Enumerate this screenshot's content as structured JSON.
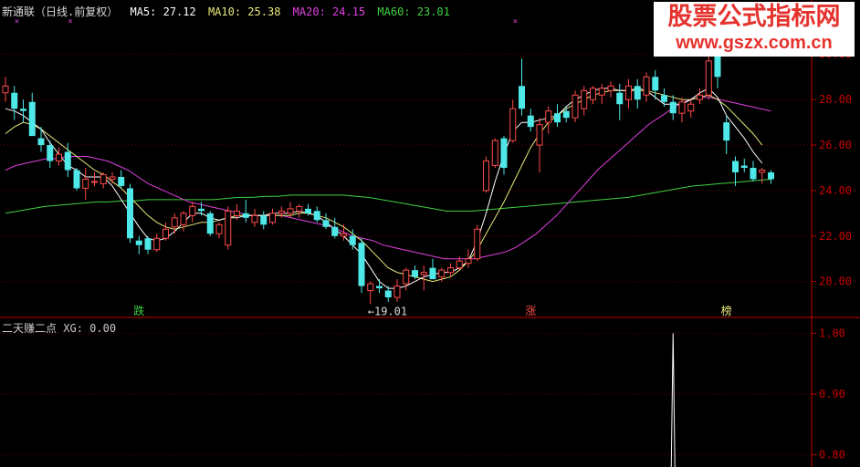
{
  "header": {
    "stock": "新通联（日线.前复权）",
    "ma5": "MA5: 27.12",
    "ma10": "MA10: 25.38",
    "ma20": "MA20: 24.15",
    "ma60": "MA60: 23.01"
  },
  "watermark": {
    "line1": "股票公式指标网",
    "line2": "www.gszx.com.cn"
  },
  "sub_header": {
    "title": "二天赚二点",
    "xg": "XG: 0.00"
  },
  "markers": {
    "low_label": "←19.01",
    "die": "跌",
    "zhang": "涨",
    "bang": "榜"
  },
  "colors": {
    "up": "#ff4a4a",
    "down": "#4fe8e8",
    "ma5": "#ffffff",
    "ma10": "#e8e87a",
    "ma20": "#e040e0",
    "ma60": "#40d040",
    "axis": "#c80000",
    "tick": "#c80000"
  },
  "chart_data": [
    {
      "type": "candlestick",
      "ylim": [
        18.5,
        31.5
      ],
      "yticks": [
        "30.00",
        "28.00",
        "26.00",
        "24.00",
        "22.00",
        "20.00"
      ],
      "candles": [
        {
          "o": 28.3,
          "h": 29.0,
          "l": 27.9,
          "c": 28.6
        },
        {
          "o": 28.3,
          "h": 28.6,
          "l": 27.1,
          "c": 27.6
        },
        {
          "o": 27.6,
          "h": 28.0,
          "l": 27.0,
          "c": 27.5
        },
        {
          "o": 27.9,
          "h": 28.3,
          "l": 26.9,
          "c": 26.4
        },
        {
          "o": 26.3,
          "h": 26.8,
          "l": 25.7,
          "c": 26.0
        },
        {
          "o": 26.0,
          "h": 26.2,
          "l": 25.0,
          "c": 25.3
        },
        {
          "o": 25.3,
          "h": 25.9,
          "l": 25.1,
          "c": 25.6
        },
        {
          "o": 25.7,
          "h": 26.1,
          "l": 24.6,
          "c": 24.9
        },
        {
          "o": 24.9,
          "h": 25.0,
          "l": 24.0,
          "c": 24.1
        },
        {
          "o": 24.1,
          "h": 25.0,
          "l": 23.6,
          "c": 24.5
        },
        {
          "o": 24.4,
          "h": 24.8,
          "l": 24.2,
          "c": 24.4
        },
        {
          "o": 24.3,
          "h": 24.8,
          "l": 24.1,
          "c": 24.7
        },
        {
          "o": 24.5,
          "h": 24.8,
          "l": 24.3,
          "c": 24.6
        },
        {
          "o": 24.6,
          "h": 24.9,
          "l": 24.1,
          "c": 24.2
        },
        {
          "o": 24.1,
          "h": 24.3,
          "l": 21.7,
          "c": 21.9
        },
        {
          "o": 21.8,
          "h": 22.0,
          "l": 21.2,
          "c": 21.6
        },
        {
          "o": 21.9,
          "h": 22.0,
          "l": 21.2,
          "c": 21.4
        },
        {
          "o": 21.4,
          "h": 22.1,
          "l": 21.3,
          "c": 21.9
        },
        {
          "o": 21.9,
          "h": 22.6,
          "l": 21.8,
          "c": 22.3
        },
        {
          "o": 22.4,
          "h": 23.0,
          "l": 22.1,
          "c": 22.8
        },
        {
          "o": 22.5,
          "h": 23.1,
          "l": 22.2,
          "c": 23.0
        },
        {
          "o": 22.9,
          "h": 23.5,
          "l": 22.6,
          "c": 23.3
        },
        {
          "o": 23.2,
          "h": 23.5,
          "l": 22.9,
          "c": 23.1
        },
        {
          "o": 23.0,
          "h": 23.1,
          "l": 22.0,
          "c": 22.1
        },
        {
          "o": 22.1,
          "h": 22.6,
          "l": 21.9,
          "c": 22.5
        },
        {
          "o": 21.6,
          "h": 23.3,
          "l": 21.4,
          "c": 23.1
        },
        {
          "o": 22.9,
          "h": 23.4,
          "l": 22.7,
          "c": 23.1
        },
        {
          "o": 23.0,
          "h": 23.6,
          "l": 22.6,
          "c": 22.8
        },
        {
          "o": 22.6,
          "h": 23.2,
          "l": 22.4,
          "c": 22.9
        },
        {
          "o": 22.9,
          "h": 23.1,
          "l": 22.3,
          "c": 22.5
        },
        {
          "o": 22.6,
          "h": 23.2,
          "l": 22.5,
          "c": 23.0
        },
        {
          "o": 23.0,
          "h": 23.3,
          "l": 22.8,
          "c": 23.1
        },
        {
          "o": 23.0,
          "h": 23.5,
          "l": 22.8,
          "c": 23.2
        },
        {
          "o": 23.1,
          "h": 23.4,
          "l": 22.8,
          "c": 23.3
        },
        {
          "o": 23.2,
          "h": 23.4,
          "l": 22.9,
          "c": 23.0
        },
        {
          "o": 23.1,
          "h": 23.3,
          "l": 22.6,
          "c": 22.7
        },
        {
          "o": 22.7,
          "h": 23.0,
          "l": 22.3,
          "c": 22.4
        },
        {
          "o": 22.4,
          "h": 22.8,
          "l": 21.9,
          "c": 22.0
        },
        {
          "o": 22.0,
          "h": 22.5,
          "l": 21.8,
          "c": 22.1
        },
        {
          "o": 22.0,
          "h": 22.3,
          "l": 21.4,
          "c": 21.6
        },
        {
          "o": 21.7,
          "h": 21.9,
          "l": 19.5,
          "c": 19.8
        },
        {
          "o": 19.6,
          "h": 20.0,
          "l": 19.01,
          "c": 19.9
        },
        {
          "o": 19.8,
          "h": 20.1,
          "l": 19.5,
          "c": 19.7
        },
        {
          "o": 19.6,
          "h": 19.8,
          "l": 19.1,
          "c": 19.3
        },
        {
          "o": 19.3,
          "h": 20.1,
          "l": 19.1,
          "c": 19.8
        },
        {
          "o": 19.9,
          "h": 20.6,
          "l": 19.6,
          "c": 20.5
        },
        {
          "o": 20.5,
          "h": 20.7,
          "l": 20.1,
          "c": 20.2
        },
        {
          "o": 20.3,
          "h": 20.7,
          "l": 19.6,
          "c": 20.4
        },
        {
          "o": 20.6,
          "h": 21.0,
          "l": 20.4,
          "c": 20.1
        },
        {
          "o": 20.2,
          "h": 20.6,
          "l": 20.0,
          "c": 20.5
        },
        {
          "o": 20.4,
          "h": 20.8,
          "l": 20.2,
          "c": 20.6
        },
        {
          "o": 20.6,
          "h": 21.1,
          "l": 20.5,
          "c": 20.9
        },
        {
          "o": 20.8,
          "h": 21.4,
          "l": 20.6,
          "c": 21.0
        },
        {
          "o": 21.0,
          "h": 22.5,
          "l": 20.9,
          "c": 22.3
        },
        {
          "o": 24.0,
          "h": 25.5,
          "l": 23.9,
          "c": 25.3
        },
        {
          "o": 25.1,
          "h": 26.3,
          "l": 25.0,
          "c": 26.2
        },
        {
          "o": 26.3,
          "h": 26.4,
          "l": 24.7,
          "c": 25.0
        },
        {
          "o": 26.2,
          "h": 28.0,
          "l": 26.1,
          "c": 27.6
        },
        {
          "o": 28.6,
          "h": 29.8,
          "l": 27.3,
          "c": 27.6
        },
        {
          "o": 27.3,
          "h": 27.6,
          "l": 26.6,
          "c": 26.8
        },
        {
          "o": 26.0,
          "h": 27.2,
          "l": 24.8,
          "c": 26.9
        },
        {
          "o": 27.0,
          "h": 27.7,
          "l": 26.5,
          "c": 27.5
        },
        {
          "o": 27.4,
          "h": 27.8,
          "l": 26.8,
          "c": 27.0
        },
        {
          "o": 27.5,
          "h": 27.7,
          "l": 27.0,
          "c": 27.2
        },
        {
          "o": 27.2,
          "h": 28.4,
          "l": 27.0,
          "c": 28.2
        },
        {
          "o": 27.6,
          "h": 28.6,
          "l": 27.3,
          "c": 28.4
        },
        {
          "o": 28.0,
          "h": 28.6,
          "l": 27.8,
          "c": 28.5
        },
        {
          "o": 28.2,
          "h": 28.7,
          "l": 27.8,
          "c": 28.5
        },
        {
          "o": 28.4,
          "h": 28.8,
          "l": 28.1,
          "c": 28.6
        },
        {
          "o": 28.3,
          "h": 28.7,
          "l": 27.1,
          "c": 27.8
        },
        {
          "o": 28.0,
          "h": 28.9,
          "l": 27.6,
          "c": 28.6
        },
        {
          "o": 28.6,
          "h": 28.9,
          "l": 27.6,
          "c": 28.0
        },
        {
          "o": 28.2,
          "h": 29.2,
          "l": 27.9,
          "c": 29.0
        },
        {
          "o": 29.0,
          "h": 29.3,
          "l": 28.0,
          "c": 28.4
        },
        {
          "o": 28.2,
          "h": 28.5,
          "l": 27.7,
          "c": 27.9
        },
        {
          "o": 27.9,
          "h": 28.2,
          "l": 27.1,
          "c": 27.4
        },
        {
          "o": 27.4,
          "h": 28.1,
          "l": 27.0,
          "c": 27.9
        },
        {
          "o": 27.5,
          "h": 28.0,
          "l": 27.2,
          "c": 27.8
        },
        {
          "o": 28.0,
          "h": 28.5,
          "l": 27.8,
          "c": 28.2
        },
        {
          "o": 28.2,
          "h": 30.0,
          "l": 28.0,
          "c": 29.7
        },
        {
          "o": 30.2,
          "h": 31.2,
          "l": 28.5,
          "c": 29.0
        },
        {
          "o": 27.0,
          "h": 27.3,
          "l": 25.6,
          "c": 26.2
        },
        {
          "o": 25.3,
          "h": 25.5,
          "l": 24.2,
          "c": 24.8
        },
        {
          "o": 25.1,
          "h": 25.4,
          "l": 24.8,
          "c": 25.0
        },
        {
          "o": 25.0,
          "h": 25.3,
          "l": 24.4,
          "c": 24.5
        },
        {
          "o": 24.8,
          "h": 25.0,
          "l": 24.3,
          "c": 24.9
        },
        {
          "o": 24.8,
          "h": 24.9,
          "l": 24.3,
          "c": 24.5
        }
      ],
      "ma5": [
        27.6,
        27.5,
        27.3,
        27.0,
        26.7,
        26.1,
        25.6,
        25.1,
        24.9,
        24.6,
        24.6,
        24.6,
        24.2,
        23.6,
        23.0,
        22.4,
        21.9,
        21.8,
        21.9,
        22.2,
        22.6,
        23.0,
        23.0,
        22.8,
        22.7,
        22.8,
        22.8,
        22.9,
        22.9,
        22.9,
        23.0,
        23.0,
        23.0,
        23.1,
        23.0,
        22.9,
        22.6,
        22.3,
        22.0,
        21.6,
        21.2,
        20.6,
        20.0,
        19.7,
        19.7,
        19.8,
        20.0,
        20.2,
        20.3,
        20.4,
        20.4,
        20.6,
        20.9,
        21.8,
        23.0,
        24.4,
        25.6,
        26.6,
        27.0,
        27.0,
        27.1,
        27.2,
        27.3,
        27.7,
        28.0,
        28.2,
        28.4,
        28.5,
        28.5,
        28.4,
        28.4,
        28.5,
        28.4,
        28.1,
        27.8,
        27.8,
        27.8,
        28.0,
        28.3,
        28.5,
        28.1,
        27.3,
        26.8,
        26.3,
        25.7,
        25.2
      ],
      "ma10": [
        26.5,
        26.8,
        27.0,
        26.9,
        26.7,
        26.4,
        26.1,
        25.8,
        25.5,
        25.2,
        24.9,
        24.7,
        24.4,
        24.1,
        23.7,
        23.3,
        22.9,
        22.6,
        22.4,
        22.3,
        22.4,
        22.5,
        22.6,
        22.6,
        22.7,
        22.8,
        22.9,
        22.9,
        22.9,
        22.9,
        22.9,
        22.9,
        22.9,
        23.0,
        23.0,
        22.9,
        22.8,
        22.6,
        22.4,
        22.1,
        21.8,
        21.4,
        21.0,
        20.6,
        20.4,
        20.3,
        20.2,
        20.1,
        20.0,
        20.1,
        20.2,
        20.5,
        20.9,
        21.4,
        22.1,
        22.8,
        23.5,
        24.3,
        25.1,
        25.9,
        26.5,
        27.0,
        27.3,
        27.6,
        27.8,
        28.0,
        28.2,
        28.3,
        28.4,
        28.4,
        28.4,
        28.4,
        28.4,
        28.3,
        28.2,
        28.1,
        28.0,
        28.0,
        28.1,
        28.2,
        28.0,
        27.7,
        27.3,
        26.9,
        26.5,
        26.0
      ],
      "ma20": [
        24.9,
        25.1,
        25.2,
        25.3,
        25.4,
        25.4,
        25.5,
        25.5,
        25.5,
        25.4,
        25.3,
        25.1,
        24.9,
        24.6,
        24.3,
        24.1,
        23.9,
        23.7,
        23.5,
        23.4,
        23.3,
        23.2,
        23.1,
        23.0,
        22.9,
        22.9,
        22.9,
        22.9,
        22.8,
        22.7,
        22.6,
        22.5,
        22.4,
        22.2,
        22.0,
        21.9,
        21.8,
        21.6,
        21.5,
        21.4,
        21.3,
        21.2,
        21.1,
        21.0,
        21.0,
        21.0,
        21.0,
        21.1,
        21.2,
        21.3,
        21.5,
        21.8,
        22.1,
        22.5,
        22.9,
        23.4,
        23.9,
        24.4,
        24.9,
        25.3,
        25.7,
        26.1,
        26.5,
        26.9,
        27.2,
        27.5,
        27.8,
        28.0,
        28.1,
        28.1,
        28.0,
        27.9,
        27.8,
        27.7,
        27.6,
        27.5
      ],
      "ma60": [
        23.0,
        23.1,
        23.2,
        23.3,
        23.35,
        23.4,
        23.45,
        23.5,
        23.5,
        23.55,
        23.55,
        23.6,
        23.6,
        23.6,
        23.6,
        23.6,
        23.6,
        23.65,
        23.7,
        23.7,
        23.75,
        23.75,
        23.8,
        23.8,
        23.8,
        23.8,
        23.8,
        23.75,
        23.7,
        23.6,
        23.5,
        23.4,
        23.3,
        23.2,
        23.1,
        23.1,
        23.1,
        23.15,
        23.2,
        23.25,
        23.3,
        23.35,
        23.4,
        23.45,
        23.5,
        23.55,
        23.6,
        23.65,
        23.7,
        23.8,
        23.9,
        24.0,
        24.1,
        24.2,
        24.25,
        24.3,
        24.35,
        24.4,
        24.45,
        24.5
      ]
    },
    {
      "type": "line",
      "ylim": [
        0.78,
        1.02
      ],
      "yticks": [
        "1.00",
        "0.90",
        "0.80"
      ],
      "spike_at_index": 75,
      "spike_value": 1.0
    }
  ]
}
